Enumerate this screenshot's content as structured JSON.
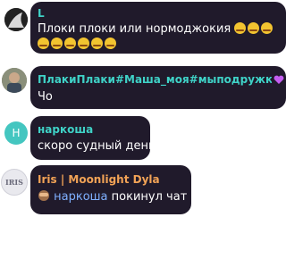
{
  "colors": {
    "bubble_bg": "#201a2b",
    "name_teal": "#3fd2c7",
    "name_orange": "#f2a356",
    "avatar_teal": "#44c6c0"
  },
  "messages": [
    {
      "sender": "L",
      "text": "Плоки плоки или нормоджокия",
      "emoji_row1_count": 3,
      "emoji_row2_count": 6
    },
    {
      "sender": "ПлакиПлаки#Маша_моя#мыподружк...",
      "sender_suffix_icon": "purple-heart-icon",
      "text": "Чо"
    },
    {
      "avatar_letter": "Н",
      "sender": "наркоша",
      "text": "скоро судный день"
    },
    {
      "avatar_text": "IRIS",
      "sender": "Iris | Moonlight Dyla",
      "system_icon": "see-no-evil-monkey-icon",
      "mentioned_user": "наркоша",
      "text": "покинул чат"
    }
  ]
}
